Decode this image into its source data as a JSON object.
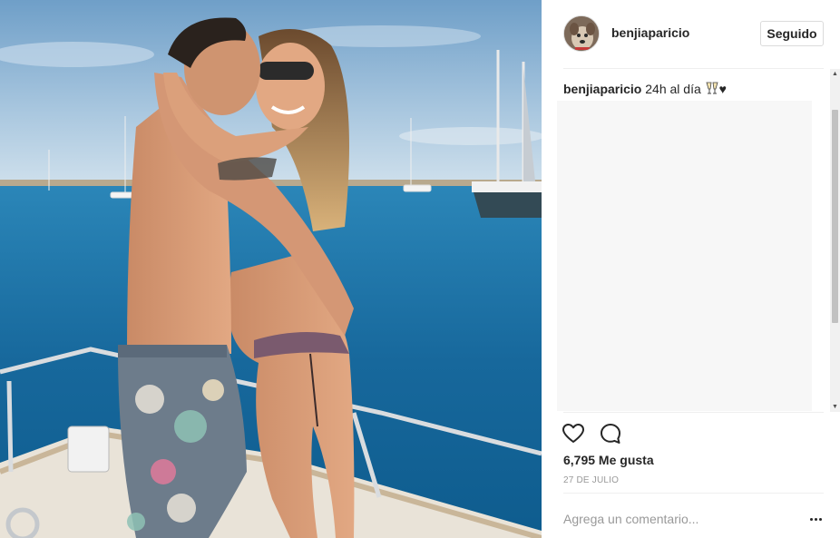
{
  "post": {
    "username": "benjiaparicio",
    "follow_label": "Seguido",
    "caption_user": "benjiaparicio",
    "caption_text": "24h al día",
    "caption_emoji": "champagne-toast-icon",
    "caption_heart": "♥",
    "likes": "6,795 Me gusta",
    "date": "27 DE JULIO",
    "comment_placeholder": "Agrega un comentario..."
  },
  "icons": {
    "like": "heart-outline-icon",
    "comment": "speech-bubble-icon",
    "more": "more-options-icon"
  },
  "colors": {
    "text": "#262626",
    "muted": "#999999",
    "border": "#dbdbdb",
    "sea": "#1f6f9e",
    "sky": "#8fb8d8"
  }
}
